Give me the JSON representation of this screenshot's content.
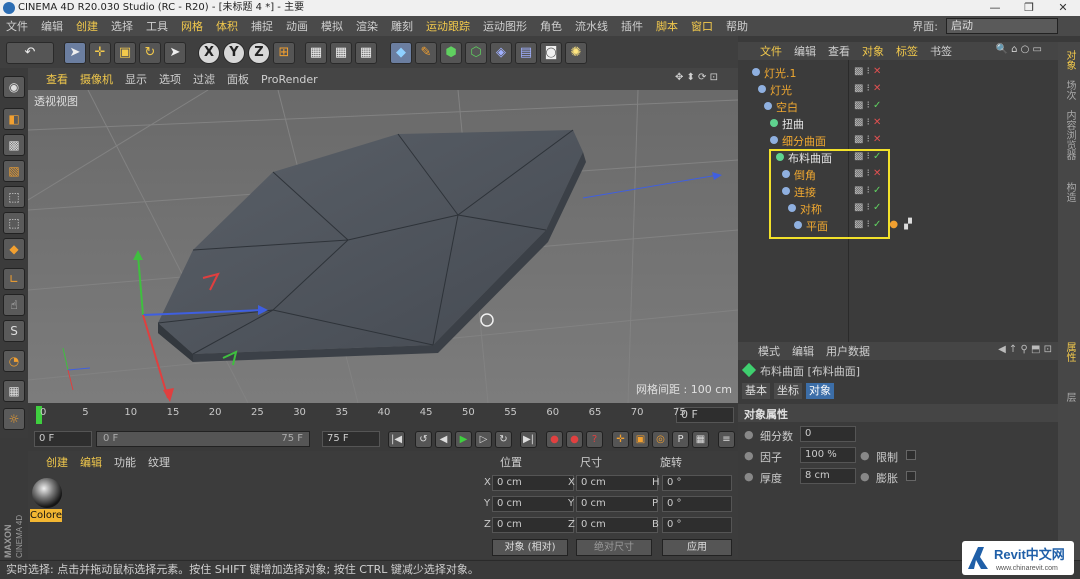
{
  "app": {
    "title": "CINEMA 4D R20.030 Studio (RC - R20) - [未标题 4 *] - 主要"
  },
  "window_controls": [
    "—",
    "❐",
    "✕"
  ],
  "menu": [
    {
      "label": "文件",
      "hl": false
    },
    {
      "label": "编辑",
      "hl": false
    },
    {
      "label": "创建",
      "hl": true
    },
    {
      "label": "选择",
      "hl": false
    },
    {
      "label": "工具",
      "hl": false
    },
    {
      "label": "网格",
      "hl": true
    },
    {
      "label": "体积",
      "hl": true
    },
    {
      "label": "捕捉",
      "hl": false
    },
    {
      "label": "动画",
      "hl": false
    },
    {
      "label": "模拟",
      "hl": false
    },
    {
      "label": "渲染",
      "hl": false
    },
    {
      "label": "雕刻",
      "hl": false
    },
    {
      "label": "运动跟踪",
      "hl": true
    },
    {
      "label": "运动图形",
      "hl": false
    },
    {
      "label": "角色",
      "hl": false
    },
    {
      "label": "流水线",
      "hl": false
    },
    {
      "label": "插件",
      "hl": false
    },
    {
      "label": "脚本",
      "hl": true
    },
    {
      "label": "窗口",
      "hl": true
    },
    {
      "label": "帮助",
      "hl": false
    }
  ],
  "layout": {
    "label": "界面:",
    "value": "启动"
  },
  "viewport_menu": [
    {
      "label": "查看",
      "hl": true
    },
    {
      "label": "摄像机",
      "hl": true
    },
    {
      "label": "显示",
      "hl": false
    },
    {
      "label": "选项",
      "hl": false
    },
    {
      "label": "过滤",
      "hl": false
    },
    {
      "label": "面板",
      "hl": false
    },
    {
      "label": "ProRender",
      "hl": false
    }
  ],
  "viewport": {
    "label": "透视视图",
    "grid_spacing": "网格间距 : 100 cm"
  },
  "timeline": {
    "ticks": [
      "0",
      "5",
      "10",
      "15",
      "20",
      "25",
      "30",
      "35",
      "40",
      "45",
      "50",
      "55",
      "60",
      "65",
      "70",
      "75"
    ],
    "current_frame": "0 F"
  },
  "transport": {
    "start": "0 F",
    "range_start": "0 F",
    "range_end": "75 F",
    "end": "75 F"
  },
  "material_tabs": [
    {
      "label": "创建",
      "hl": true
    },
    {
      "label": "编辑",
      "hl": true
    },
    {
      "label": "功能",
      "hl": false
    },
    {
      "label": "纹理",
      "hl": false
    }
  ],
  "material": {
    "name": "Colore"
  },
  "coords": {
    "headers": [
      "位置",
      "尺寸",
      "旋转"
    ],
    "pos": [
      {
        "axis": "X",
        "value": "0 cm"
      },
      {
        "axis": "Y",
        "value": "0 cm"
      },
      {
        "axis": "Z",
        "value": "0 cm"
      }
    ],
    "size": [
      {
        "axis": "X",
        "value": "0 cm"
      },
      {
        "axis": "Y",
        "value": "0 cm"
      },
      {
        "axis": "Z",
        "value": "0 cm"
      }
    ],
    "rot": [
      {
        "axis": "H",
        "value": "0 °"
      },
      {
        "axis": "P",
        "value": "0 °"
      },
      {
        "axis": "B",
        "value": "0 °"
      }
    ],
    "mode": "对象 (相对)",
    "size_mode": "绝对尺寸",
    "apply": "应用"
  },
  "objects_header": [
    {
      "label": "文件",
      "hl": true
    },
    {
      "label": "编辑",
      "hl": false
    },
    {
      "label": "查看",
      "hl": false
    },
    {
      "label": "对象",
      "hl": true
    },
    {
      "label": "标签",
      "hl": true
    },
    {
      "label": "书签",
      "hl": false
    }
  ],
  "objects": [
    {
      "name": "灯光.1",
      "color": "o",
      "indent": 0,
      "flag": "x"
    },
    {
      "name": "灯光",
      "color": "o",
      "indent": 1,
      "flag": "x"
    },
    {
      "name": "空白",
      "color": "o",
      "indent": 2,
      "flag": "c"
    },
    {
      "name": "扭曲",
      "color": "w",
      "indent": 3,
      "flag": "x"
    },
    {
      "name": "细分曲面",
      "color": "o",
      "indent": 3,
      "flag": "x"
    },
    {
      "name": "布料曲面",
      "color": "w",
      "indent": 4,
      "flag": "c"
    },
    {
      "name": "倒角",
      "color": "o",
      "indent": 5,
      "flag": "x"
    },
    {
      "name": "连接",
      "color": "o",
      "indent": 5,
      "flag": "c"
    },
    {
      "name": "对称",
      "color": "o",
      "indent": 6,
      "flag": "c"
    },
    {
      "name": "平面",
      "color": "o",
      "indent": 7,
      "flag": "c"
    }
  ],
  "attr_header": [
    "模式",
    "编辑",
    "用户数据"
  ],
  "attributes": {
    "object_title": "布料曲面 [布料曲面]",
    "tabs": [
      {
        "label": "基本",
        "sel": false
      },
      {
        "label": "坐标",
        "sel": false
      },
      {
        "label": "对象",
        "sel": true
      }
    ],
    "section": "对象属性",
    "subdivisions": {
      "label": "细分数",
      "value": "0"
    },
    "factor": {
      "label": "因子",
      "value": "100 %"
    },
    "limit": {
      "label": "限制"
    },
    "thickness": {
      "label": "厚度",
      "value": "8 cm"
    },
    "expand": {
      "label": "膨胀"
    }
  },
  "sidebar_tabs": [
    {
      "label": "对象",
      "hl": true
    },
    {
      "label": "场次",
      "hl": false
    },
    {
      "label": "内容浏览器",
      "hl": false
    },
    {
      "label": "构造",
      "hl": false
    },
    {
      "label": "属性",
      "hl": true
    },
    {
      "label": "层",
      "hl": false
    }
  ],
  "status": "实时选择: 点击并拖动鼠标选择元素。按住 SHIFT 键增加选择对象; 按住 CTRL 键减少选择对象。",
  "watermark": {
    "brand": "Revit中文网",
    "url": "www.chinarevit.com"
  }
}
